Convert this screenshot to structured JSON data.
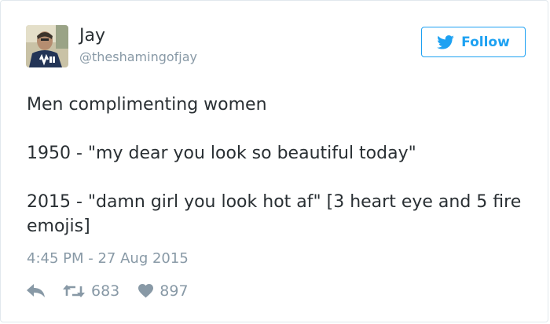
{
  "user": {
    "display_name": "Jay",
    "screen_name": "@theshamingofjay",
    "avatar_icon": "user-avatar-photo"
  },
  "follow_button": {
    "label": "Follow",
    "icon": "twitter-bird-icon",
    "color": "#1da1f2"
  },
  "tweet": {
    "paragraphs": [
      "Men complimenting women",
      "1950 - \"my dear you look so beautiful today\"",
      "2015 - \"damn girl you look hot af\" [3 heart eye and 5 fire emojis]"
    ],
    "timestamp": "4:45 PM - 27 Aug 2015"
  },
  "actions": {
    "reply_icon": "reply-icon",
    "retweet_icon": "retweet-icon",
    "retweet_count": "683",
    "like_icon": "heart-icon",
    "like_count": "897"
  },
  "colors": {
    "text": "#292f33",
    "muted": "#8899a6",
    "border": "#e1e8ed"
  }
}
